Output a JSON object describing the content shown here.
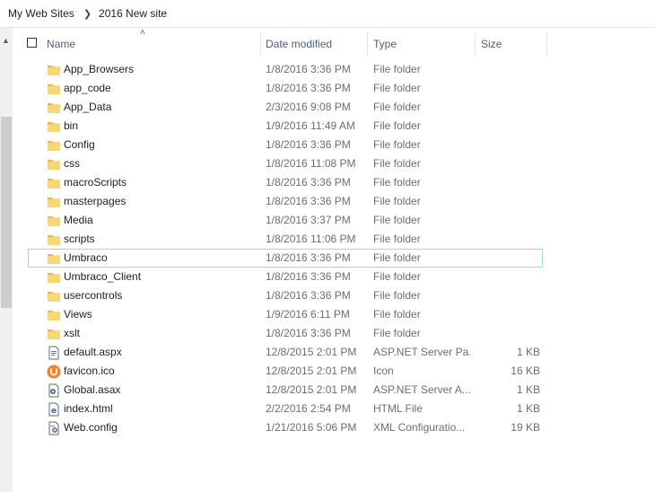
{
  "breadcrumb": {
    "items": [
      "My Web Sites",
      "2016 New site"
    ],
    "separator_icon": "chevron-right-icon"
  },
  "columns": {
    "name": "Name",
    "date_modified": "Date modified",
    "type": "Type",
    "size": "Size",
    "sort_icon": "sort-ascending-icon"
  },
  "colors": {
    "folder": "#f8d775",
    "selection_border": "#99d1ff",
    "header_text": "#4c607a",
    "secondary_text": "#6d6d6d"
  },
  "files": [
    {
      "name": "App_Browsers",
      "date": "1/8/2016 3:36 PM",
      "type": "File folder",
      "size": "",
      "icon": "folder-icon"
    },
    {
      "name": "app_code",
      "date": "1/8/2016 3:36 PM",
      "type": "File folder",
      "size": "",
      "icon": "folder-icon"
    },
    {
      "name": "App_Data",
      "date": "2/3/2016 9:08 PM",
      "type": "File folder",
      "size": "",
      "icon": "folder-icon"
    },
    {
      "name": "bin",
      "date": "1/9/2016 11:49 AM",
      "type": "File folder",
      "size": "",
      "icon": "folder-icon"
    },
    {
      "name": "Config",
      "date": "1/8/2016 3:36 PM",
      "type": "File folder",
      "size": "",
      "icon": "folder-icon"
    },
    {
      "name": "css",
      "date": "1/8/2016 11:08 PM",
      "type": "File folder",
      "size": "",
      "icon": "folder-icon"
    },
    {
      "name": "macroScripts",
      "date": "1/8/2016 3:36 PM",
      "type": "File folder",
      "size": "",
      "icon": "folder-icon"
    },
    {
      "name": "masterpages",
      "date": "1/8/2016 3:36 PM",
      "type": "File folder",
      "size": "",
      "icon": "folder-icon"
    },
    {
      "name": "Media",
      "date": "1/8/2016 3:37 PM",
      "type": "File folder",
      "size": "",
      "icon": "folder-icon"
    },
    {
      "name": "scripts",
      "date": "1/8/2016 11:06 PM",
      "type": "File folder",
      "size": "",
      "icon": "folder-icon"
    },
    {
      "name": "Umbraco",
      "date": "1/8/2016 3:36 PM",
      "type": "File folder",
      "size": "",
      "icon": "folder-icon",
      "selected": true
    },
    {
      "name": "Umbraco_Client",
      "date": "1/8/2016 3:36 PM",
      "type": "File folder",
      "size": "",
      "icon": "folder-icon"
    },
    {
      "name": "usercontrols",
      "date": "1/8/2016 3:36 PM",
      "type": "File folder",
      "size": "",
      "icon": "folder-icon"
    },
    {
      "name": "Views",
      "date": "1/9/2016 6:11 PM",
      "type": "File folder",
      "size": "",
      "icon": "folder-icon"
    },
    {
      "name": "xslt",
      "date": "1/8/2016 3:36 PM",
      "type": "File folder",
      "size": "",
      "icon": "folder-icon"
    },
    {
      "name": "default.aspx",
      "date": "12/8/2015 2:01 PM",
      "type": "ASP.NET Server Pa...",
      "size": "1 KB",
      "icon": "aspx-file-icon"
    },
    {
      "name": "favicon.ico",
      "date": "12/8/2015 2:01 PM",
      "type": "Icon",
      "size": "16 KB",
      "icon": "umbraco-icon"
    },
    {
      "name": "Global.asax",
      "date": "12/8/2015 2:01 PM",
      "type": "ASP.NET Server A...",
      "size": "1 KB",
      "icon": "asax-file-icon"
    },
    {
      "name": "index.html",
      "date": "2/2/2016 2:54 PM",
      "type": "HTML File",
      "size": "1 KB",
      "icon": "html-file-icon"
    },
    {
      "name": "Web.config",
      "date": "1/21/2016 5:06 PM",
      "type": "XML Configuratio...",
      "size": "19 KB",
      "icon": "config-file-icon"
    }
  ]
}
